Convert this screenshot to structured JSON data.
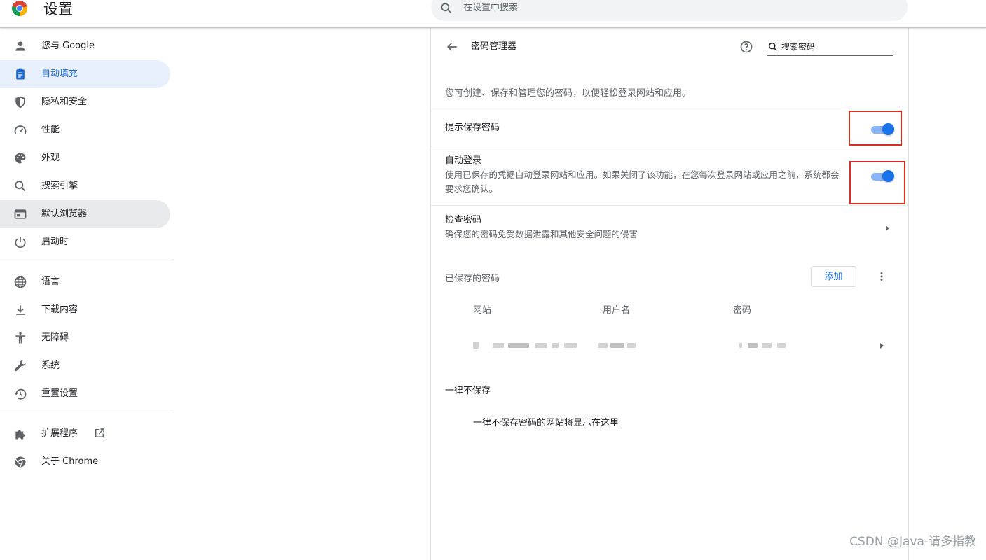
{
  "app": {
    "title": "设置",
    "logo_icon": "chrome-logo-icon"
  },
  "search": {
    "placeholder": "在设置中搜索",
    "icon": "search-icon"
  },
  "sidebar": {
    "items": [
      {
        "label": "您与 Google",
        "icon": "person-icon",
        "state": "normal"
      },
      {
        "label": "自动填充",
        "icon": "clipboard-icon",
        "state": "active"
      },
      {
        "label": "隐私和安全",
        "icon": "shield-icon",
        "state": "normal"
      },
      {
        "label": "性能",
        "icon": "speedometer-icon",
        "state": "normal"
      },
      {
        "label": "外观",
        "icon": "palette-icon",
        "state": "normal"
      },
      {
        "label": "搜索引擎",
        "icon": "search-icon",
        "state": "normal"
      },
      {
        "label": "默认浏览器",
        "icon": "browser-window-icon",
        "state": "hover"
      },
      {
        "label": "启动时",
        "icon": "power-icon",
        "state": "normal"
      }
    ],
    "items2": [
      {
        "label": "语言",
        "icon": "globe-icon"
      },
      {
        "label": "下载内容",
        "icon": "download-icon"
      },
      {
        "label": "无障碍",
        "icon": "accessibility-icon"
      },
      {
        "label": "系统",
        "icon": "wrench-icon"
      },
      {
        "label": "重置设置",
        "icon": "history-icon"
      }
    ],
    "items3": [
      {
        "label": "扩展程序",
        "icon": "puzzle-icon"
      },
      {
        "label": "关于 Chrome",
        "icon": "chrome-icon"
      }
    ]
  },
  "password_manager": {
    "title": "密码管理器",
    "search_placeholder": "搜索密码",
    "description": "您可创建、保存和管理您的密码，以便轻松登录网站和应用。",
    "offer_to_save": {
      "label": "提示保存密码",
      "enabled": true
    },
    "auto_signin": {
      "label": "自动登录",
      "sub_line1": "使用已保存的凭据自动登录网站和应用。如果关闭了该功能，在您每次登录网站或应用之前，系统都会",
      "sub_line2": "要求您确认。",
      "enabled": true
    },
    "check_passwords": {
      "label": "检查密码",
      "sub": "确保您的密码免受数据泄露和其他安全问题的侵害"
    },
    "saved": {
      "heading": "已保存的密码",
      "add_label": "添加",
      "columns": [
        "网站",
        "用户名",
        "密码"
      ]
    },
    "never_saved": {
      "heading": "一律不保存",
      "empty": "一律不保存密码的网站将显示在这里"
    }
  },
  "watermark": "CSDN @Java-请多指教",
  "colors": {
    "accent": "#1a73e8",
    "active_bg": "#e8f0fe",
    "highlight": "#d93025"
  }
}
